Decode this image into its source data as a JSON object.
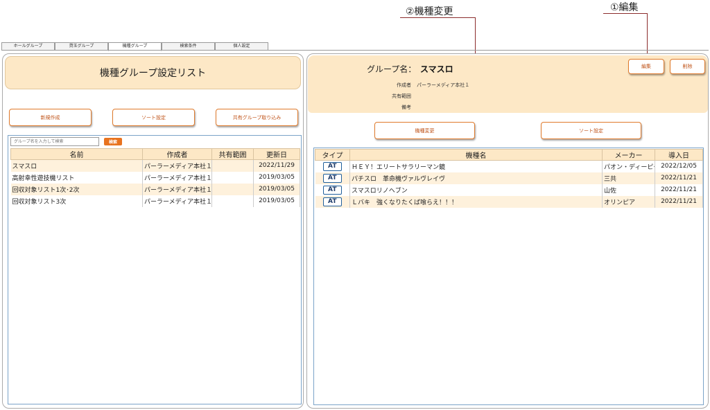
{
  "annotations": {
    "callout_2": "②機種変更",
    "callout_1": "①編集"
  },
  "tabs": [
    {
      "label": "ホールグループ",
      "active": false
    },
    {
      "label": "貸玉グループ",
      "active": false
    },
    {
      "label": "機種グループ",
      "active": true
    },
    {
      "label": "検索条件",
      "active": false
    },
    {
      "label": "個人設定",
      "active": false
    }
  ],
  "left": {
    "title": "機種グループ設定リスト",
    "buttons": {
      "new": "新規作成",
      "sort": "ソート設定",
      "import_shared": "共有グループ取り込み"
    },
    "search": {
      "placeholder": "グループ名を入力して検索",
      "button": "検索"
    },
    "columns": [
      "名前",
      "作成者",
      "共有範囲",
      "更新日"
    ],
    "rows": [
      [
        "スマスロ",
        "パーラーメディア本社１",
        "",
        "2022/11/29"
      ],
      [
        "高射幸性遊技機リスト",
        "パーラーメディア本社１",
        "",
        "2019/03/05"
      ],
      [
        "回収対象リスト1次･2次",
        "パーラーメディア本社１",
        "",
        "2019/03/05"
      ],
      [
        "回収対象リスト3次",
        "パーラーメディア本社１",
        "",
        "2019/03/05"
      ]
    ]
  },
  "right": {
    "group_label": "グループ名：",
    "group_name": "スマスロ",
    "buttons": {
      "edit": "編集",
      "delete": "削除",
      "change_models": "機種変更",
      "sort": "ソート設定"
    },
    "meta": [
      {
        "label": "作成者",
        "value": "パーラーメディア本社１"
      },
      {
        "label": "共有範囲",
        "value": ""
      },
      {
        "label": "備考",
        "value": ""
      }
    ],
    "columns": [
      "タイプ",
      "機種名",
      "メーカー",
      "導入日"
    ],
    "rows": [
      [
        "AT",
        "ＨＥＹ！エリートサラリーマン鏡",
        "パオン・ディーピー",
        "2022/12/05"
      ],
      [
        "AT",
        "パチスロ　革命機ヴァルヴレイヴ",
        "三共",
        "2022/11/21"
      ],
      [
        "AT",
        "スマスロリノヘブン",
        "山佐",
        "2022/11/21"
      ],
      [
        "AT",
        "Ｌバキ　強くなりたくば喰らえ！！！",
        "オリンピア",
        "2022/11/21"
      ]
    ]
  },
  "colors": {
    "accent": "#e8731f",
    "header_bg": "#fde8c6",
    "callout": "#8b2b2b",
    "badge": "#1f5f9b"
  }
}
